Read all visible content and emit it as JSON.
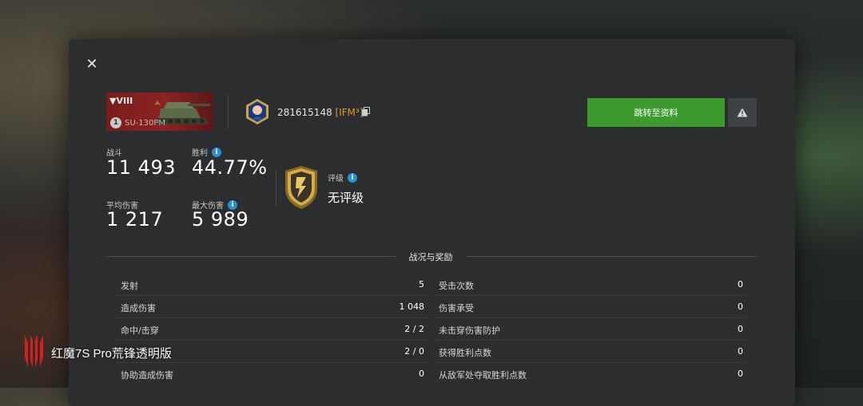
{
  "tank": {
    "tier": "▼VIII",
    "name": "SU-130PM",
    "mastery": "1"
  },
  "player": {
    "name": "281615148",
    "clan": "[IFM³]"
  },
  "actions": {
    "goto_profile": "跳转至资料"
  },
  "stats": [
    {
      "label": "战斗",
      "value": "11 493",
      "info": false
    },
    {
      "label": "胜利",
      "value": "44.77%",
      "info": true
    },
    {
      "label": "平均伤害",
      "value": "1 217",
      "info": false
    },
    {
      "label": "最大伤害",
      "value": "5 989",
      "info": true
    }
  ],
  "rating": {
    "label": "评级",
    "value": "无评级"
  },
  "section_title": "战况与奖励",
  "left_rows": [
    {
      "label": "发射",
      "value": "5"
    },
    {
      "label": "造成伤害",
      "value": "1 048"
    },
    {
      "label": "命中/击穿",
      "value": "2 / 2"
    },
    {
      "label": "",
      "value": "2 / 0"
    },
    {
      "label": "协助造成伤害",
      "value": "0"
    }
  ],
  "right_rows": [
    {
      "label": "受击次数",
      "value": "0"
    },
    {
      "label": "伤害承受",
      "value": "0"
    },
    {
      "label": "未击穿伤害防护",
      "value": "0"
    },
    {
      "label": "获得胜利点数",
      "value": "0"
    },
    {
      "label": "从敌军处夺取胜利点数",
      "value": "0"
    }
  ],
  "watermark": "红魔7S Pro荒锋透明版",
  "colors": {
    "accent_green": "#3d9b2e",
    "info_blue": "#2b8fd6",
    "clan_orange": "#e0992c",
    "tank_red": "#8b2323"
  },
  "icons": [
    "close-icon",
    "copy-icon",
    "warning-icon",
    "info-icon",
    "rating-emblem-icon",
    "tank-icon"
  ]
}
